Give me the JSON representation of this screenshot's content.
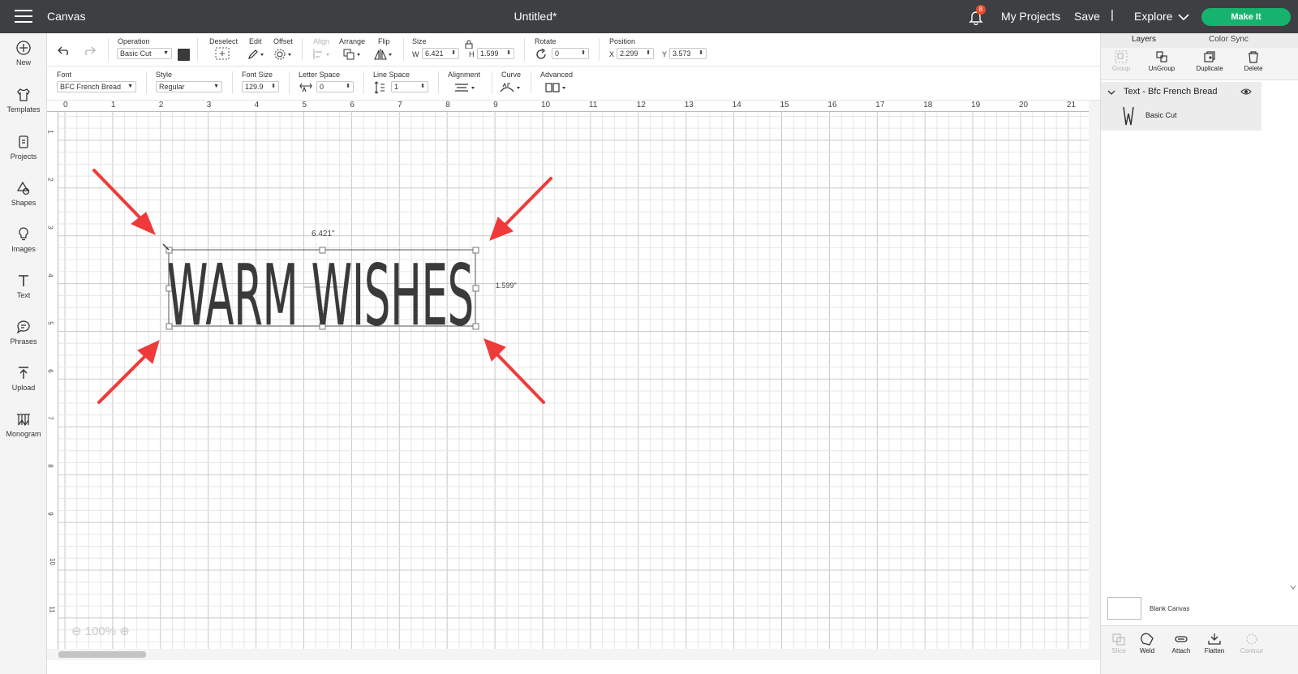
{
  "topbar": {
    "app_title": "Canvas",
    "doc_title": "Untitled*",
    "notification_count": "8",
    "my_projects": "My Projects",
    "save": "Save",
    "separator": "|",
    "explore": "Explore",
    "make_it": "Make It"
  },
  "leftnav": {
    "items": [
      {
        "label": "New",
        "icon": "plus-circle-icon"
      },
      {
        "label": "Templates",
        "icon": "shirt-icon"
      },
      {
        "label": "Projects",
        "icon": "clipboard-icon"
      },
      {
        "label": "Shapes",
        "icon": "shapes-icon"
      },
      {
        "label": "Images",
        "icon": "lightbulb-icon"
      },
      {
        "label": "Text",
        "icon": "text-t-icon"
      },
      {
        "label": "Phrases",
        "icon": "speech-bubble-icon"
      },
      {
        "label": "Upload",
        "icon": "upload-icon"
      },
      {
        "label": "Monogram",
        "icon": "monogram-icon"
      }
    ]
  },
  "toolbar1": {
    "operation_label": "Operation",
    "operation_value": "Basic Cut",
    "deselect_label": "Deselect",
    "edit_label": "Edit",
    "offset_label": "Offset",
    "align_label": "Align",
    "arrange_label": "Arrange",
    "flip_label": "Flip",
    "size_label": "Size",
    "w_label": "W",
    "w_value": "6.421",
    "h_label": "H",
    "h_value": "1.599",
    "rotate_label": "Rotate",
    "rotate_value": "0",
    "position_label": "Position",
    "x_label": "X",
    "x_value": "2.299",
    "y_label": "Y",
    "y_value": "3.573"
  },
  "toolbar2": {
    "font_label": "Font",
    "font_value": "BFC French Bread",
    "style_label": "Style",
    "style_value": "Regular",
    "font_size_label": "Font Size",
    "font_size_value": "129.9",
    "letter_space_label": "Letter Space",
    "letter_space_value": "0",
    "line_space_label": "Line Space",
    "line_space_value": "1",
    "alignment_label": "Alignment",
    "curve_label": "Curve",
    "advanced_label": "Advanced"
  },
  "rulers": {
    "top": [
      "0",
      "1",
      "2",
      "3",
      "4",
      "5",
      "6",
      "7",
      "8",
      "9",
      "10",
      "11",
      "12",
      "13",
      "14",
      "15",
      "16",
      "17",
      "18",
      "19",
      "20",
      "21"
    ],
    "left": [
      "1",
      "2",
      "3",
      "4",
      "5",
      "6",
      "7",
      "8",
      "9",
      "10",
      "11"
    ]
  },
  "canvas": {
    "text": "WARM WISHES",
    "width_dim": "6.421\"",
    "height_dim": "1.599\"",
    "zoom": "100%",
    "annotation_color": "#f03a3a"
  },
  "rightpanel": {
    "tab_layers": "Layers",
    "tab_color_sync": "Color Sync",
    "actions": [
      "Group",
      "UnGroup",
      "Duplicate",
      "Delete"
    ],
    "layer_title": "Text - Bfc French Bread",
    "layer_sub": "Basic Cut",
    "blank_canvas": "Blank Canvas",
    "bottom_actions": [
      "Slice",
      "Weld",
      "Attach",
      "Flatten",
      "Contour"
    ]
  }
}
